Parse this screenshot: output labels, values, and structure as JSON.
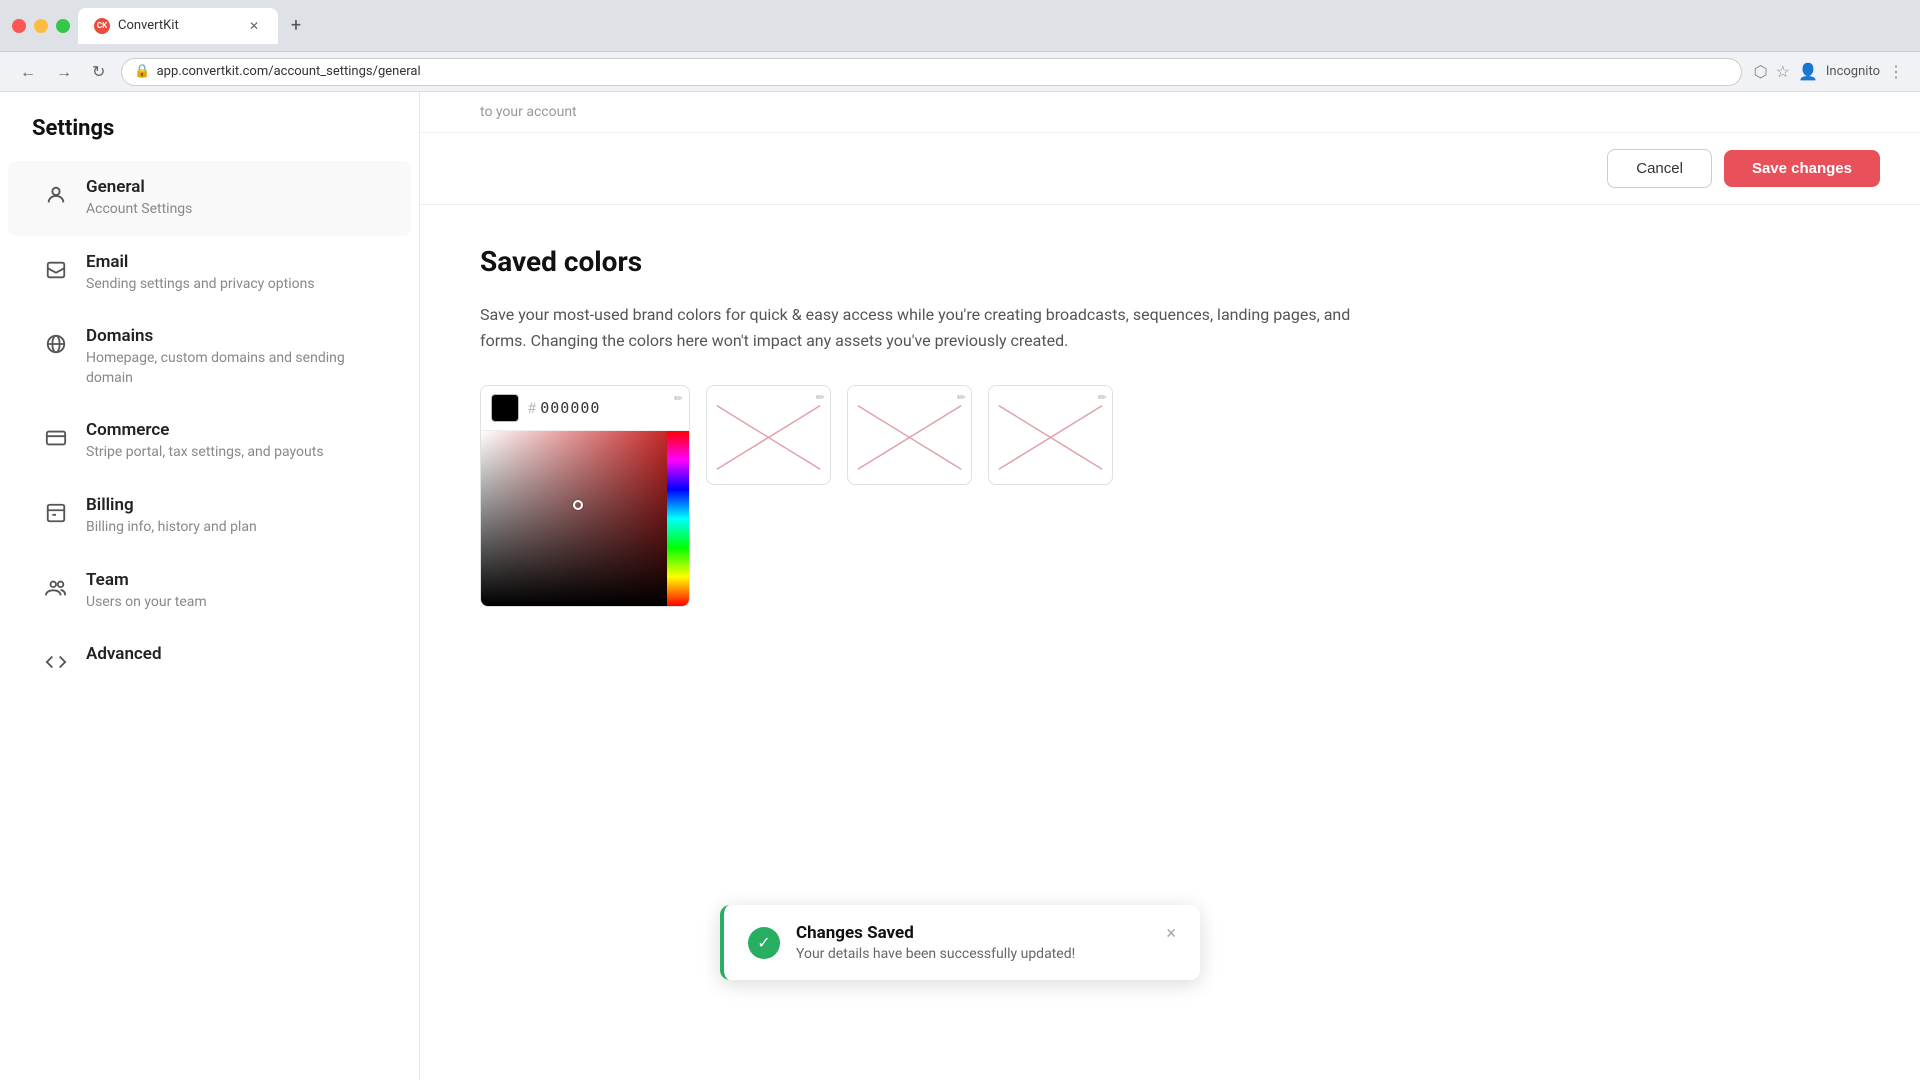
{
  "browser": {
    "tab_title": "ConvertKit",
    "tab_favicon": "CK",
    "url": "app.convertkit.com/account_settings/general",
    "incognito_label": "Incognito"
  },
  "top_partial": {
    "text": "to your account"
  },
  "action_bar": {
    "cancel_label": "Cancel",
    "save_label": "Save changes"
  },
  "sidebar": {
    "title": "Settings",
    "items": [
      {
        "id": "general",
        "label": "General",
        "sub": "Account Settings",
        "icon": "person"
      },
      {
        "id": "email",
        "label": "Email",
        "sub": "Sending settings and privacy options",
        "icon": "inbox"
      },
      {
        "id": "domains",
        "label": "Domains",
        "sub": "Homepage, custom domains and sending domain",
        "icon": "globe"
      },
      {
        "id": "commerce",
        "label": "Commerce",
        "sub": "Stripe portal, tax settings, and payouts",
        "icon": "card"
      },
      {
        "id": "billing",
        "label": "Billing",
        "sub": "Billing info, history and plan",
        "icon": "billing"
      },
      {
        "id": "team",
        "label": "Team",
        "sub": "Users on your team",
        "icon": "team"
      },
      {
        "id": "advanced",
        "label": "Advanced",
        "sub": "",
        "icon": "code"
      }
    ]
  },
  "main": {
    "section_title": "Saved colors",
    "section_desc": "Save your most-used brand colors for quick & easy access while you're creating broadcasts, sequences, landing pages, and forms. Changing the colors here won't impact any assets you've previously created.",
    "color_hex": "000000",
    "color_hash_symbol": "#"
  },
  "toast": {
    "title": "Changes Saved",
    "sub": "Your details have been successfully updated!",
    "close_label": "×"
  }
}
